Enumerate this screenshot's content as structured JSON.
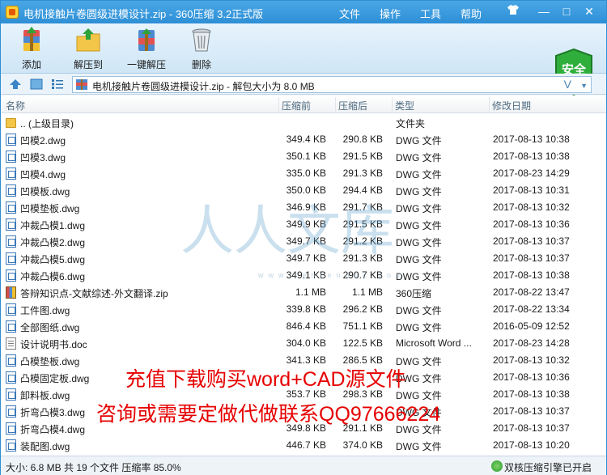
{
  "titlebar": {
    "title": "电机接触片卷圆级进模设计.zip - 360压缩 3.2正式版",
    "menus": [
      "文件",
      "操作",
      "工具",
      "帮助"
    ],
    "skin_icon": "shirt-icon",
    "minimize": "—",
    "maximize": "□",
    "close": "✕"
  },
  "toolbar": {
    "buttons": [
      {
        "label": "添加",
        "icon": "add-archive-icon"
      },
      {
        "label": "解压到",
        "icon": "extract-to-icon"
      },
      {
        "label": "一键解压",
        "icon": "one-click-extract-icon"
      },
      {
        "label": "删除",
        "icon": "delete-bin-icon"
      }
    ],
    "security_label": "安全"
  },
  "addressbar": {
    "path": "电机接触片卷圆级进模设计.zip - 解包大小为 8.0 MB",
    "v_mark": "V",
    "dropdown": "▼"
  },
  "columns": {
    "name": "名称",
    "size": "压缩前",
    "compressed": "压缩后",
    "type": "类型",
    "date": "修改日期"
  },
  "files": [
    {
      "icon": "folder",
      "name": ".. (上级目录)",
      "size": "",
      "compressed": "",
      "type": "文件夹",
      "date": ""
    },
    {
      "icon": "dwg",
      "name": "凹模2.dwg",
      "size": "349.4 KB",
      "compressed": "290.8 KB",
      "type": "DWG 文件",
      "date": "2017-08-13 10:38"
    },
    {
      "icon": "dwg",
      "name": "凹模3.dwg",
      "size": "350.1 KB",
      "compressed": "291.5 KB",
      "type": "DWG 文件",
      "date": "2017-08-13 10:38"
    },
    {
      "icon": "dwg",
      "name": "凹模4.dwg",
      "size": "335.0 KB",
      "compressed": "291.3 KB",
      "type": "DWG 文件",
      "date": "2017-08-23 14:29"
    },
    {
      "icon": "dwg",
      "name": "凹模板.dwg",
      "size": "350.0 KB",
      "compressed": "294.4 KB",
      "type": "DWG 文件",
      "date": "2017-08-13 10:31"
    },
    {
      "icon": "dwg",
      "name": "凹模垫板.dwg",
      "size": "346.9 KB",
      "compressed": "291.7 KB",
      "type": "DWG 文件",
      "date": "2017-08-13 10:32"
    },
    {
      "icon": "dwg",
      "name": "冲裁凸模1.dwg",
      "size": "349.9 KB",
      "compressed": "291.5 KB",
      "type": "DWG 文件",
      "date": "2017-08-13 10:36"
    },
    {
      "icon": "dwg",
      "name": "冲裁凸模2.dwg",
      "size": "349.7 KB",
      "compressed": "291.2 KB",
      "type": "DWG 文件",
      "date": "2017-08-13 10:37"
    },
    {
      "icon": "dwg",
      "name": "冲裁凸模5.dwg",
      "size": "349.7 KB",
      "compressed": "291.3 KB",
      "type": "DWG 文件",
      "date": "2017-08-13 10:37"
    },
    {
      "icon": "dwg",
      "name": "冲裁凸模6.dwg",
      "size": "349.1 KB",
      "compressed": "290.7 KB",
      "type": "DWG 文件",
      "date": "2017-08-13 10:38"
    },
    {
      "icon": "zip",
      "name": "答辩知识点-文献综述-外文翻译.zip",
      "size": "1.1 MB",
      "compressed": "1.1 MB",
      "type": "360压缩",
      "date": "2017-08-22 13:47"
    },
    {
      "icon": "dwg",
      "name": "工件图.dwg",
      "size": "339.8 KB",
      "compressed": "296.2 KB",
      "type": "DWG 文件",
      "date": "2017-08-22 13:34"
    },
    {
      "icon": "dwg",
      "name": "全部图纸.dwg",
      "size": "846.4 KB",
      "compressed": "751.1 KB",
      "type": "DWG 文件",
      "date": "2016-05-09 12:52"
    },
    {
      "icon": "doc",
      "name": "设计说明书.doc",
      "size": "304.0 KB",
      "compressed": "122.5 KB",
      "type": "Microsoft Word ...",
      "date": "2017-08-23 14:28"
    },
    {
      "icon": "dwg",
      "name": "凸模垫板.dwg",
      "size": "341.3 KB",
      "compressed": "286.5 KB",
      "type": "DWG 文件",
      "date": "2017-08-13 10:32"
    },
    {
      "icon": "dwg",
      "name": "凸模固定板.dwg",
      "size": "",
      "compressed": "",
      "type": "DWG 文件",
      "date": "2017-08-13 10:36"
    },
    {
      "icon": "dwg",
      "name": "卸料板.dwg",
      "size": "353.7 KB",
      "compressed": "298.3 KB",
      "type": "DWG 文件",
      "date": "2017-08-13 10:38"
    },
    {
      "icon": "dwg",
      "name": "折弯凸模3.dwg",
      "size": "",
      "compressed": "",
      "type": "DWG 文件",
      "date": "2017-08-13 10:37"
    },
    {
      "icon": "dwg",
      "name": "折弯凸模4.dwg",
      "size": "349.8 KB",
      "compressed": "291.1 KB",
      "type": "DWG 文件",
      "date": "2017-08-13 10:37"
    },
    {
      "icon": "dwg",
      "name": "装配图.dwg",
      "size": "446.7 KB",
      "compressed": "374.0 KB",
      "type": "DWG 文件",
      "date": "2017-08-13 10:20"
    }
  ],
  "overlay": {
    "line1": "充值下载购买word+CAD源文件",
    "line2": "咨询或需要定做代做联系QQ97666224",
    "color": "#e60000"
  },
  "watermark": {
    "text": "人人文库",
    "url": "www.renrendoc.com"
  },
  "status": {
    "summary": "大小: 6.8 MB 共 19 个文件 压缩率 85.0%",
    "right": "双核压缩引擎已开启"
  }
}
